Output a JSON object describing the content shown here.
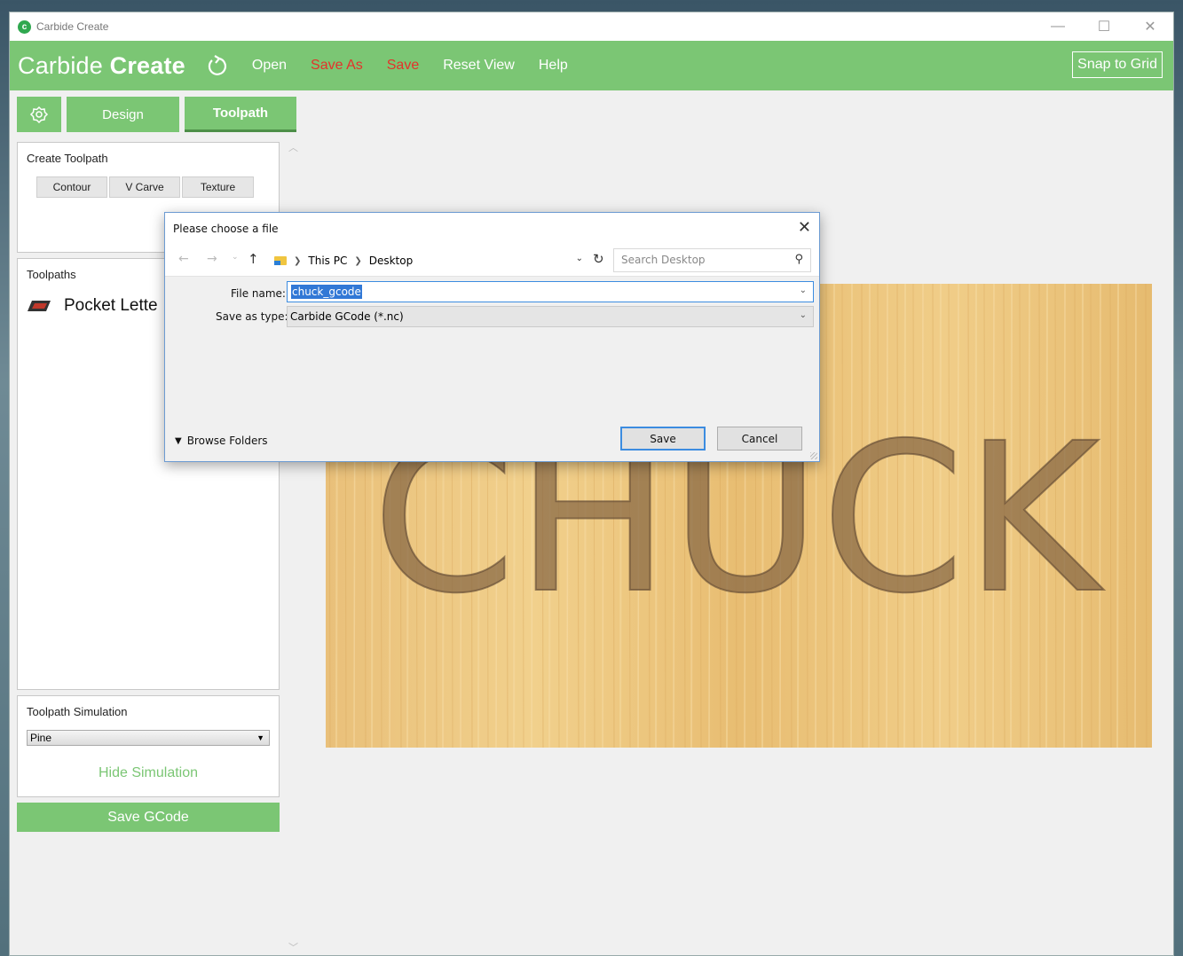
{
  "window": {
    "title": "Carbide Create",
    "controls": {
      "minimize": "—",
      "maximize": "☐",
      "close": "✕"
    }
  },
  "menubar": {
    "brand_regular": "Carbide ",
    "brand_bold": "Create",
    "items": [
      "Open",
      "Save As",
      "Save",
      "Reset View",
      "Help"
    ],
    "snap": "Snap to Grid"
  },
  "tabs": {
    "design": "Design",
    "toolpath": "Toolpath"
  },
  "create_toolpath": {
    "title": "Create Toolpath",
    "buttons": [
      "Contour",
      "V Carve",
      "Texture"
    ]
  },
  "toolpaths": {
    "title": "Toolpaths",
    "items": [
      "Pocket Lette"
    ]
  },
  "simulation": {
    "title": "Toolpath Simulation",
    "material": "Pine",
    "hide_label": "Hide Simulation"
  },
  "save_gcode": "Save GCode",
  "canvas": {
    "text": "CHUCK"
  },
  "dialog": {
    "title": "Please choose a file",
    "breadcrumb": [
      "This PC",
      "Desktop"
    ],
    "search_placeholder": "Search Desktop",
    "file_name_label": "File name:",
    "file_name_value": "chuck_gcode",
    "save_type_label": "Save as type:",
    "save_type_value": "Carbide GCode (*.nc)",
    "browse_label": "Browse Folders",
    "save_button": "Save",
    "cancel_button": "Cancel"
  },
  "colors": {
    "accent_green": "#7bc674",
    "menu_red": "#e4322b",
    "dialog_focus": "#3c8ce0"
  }
}
